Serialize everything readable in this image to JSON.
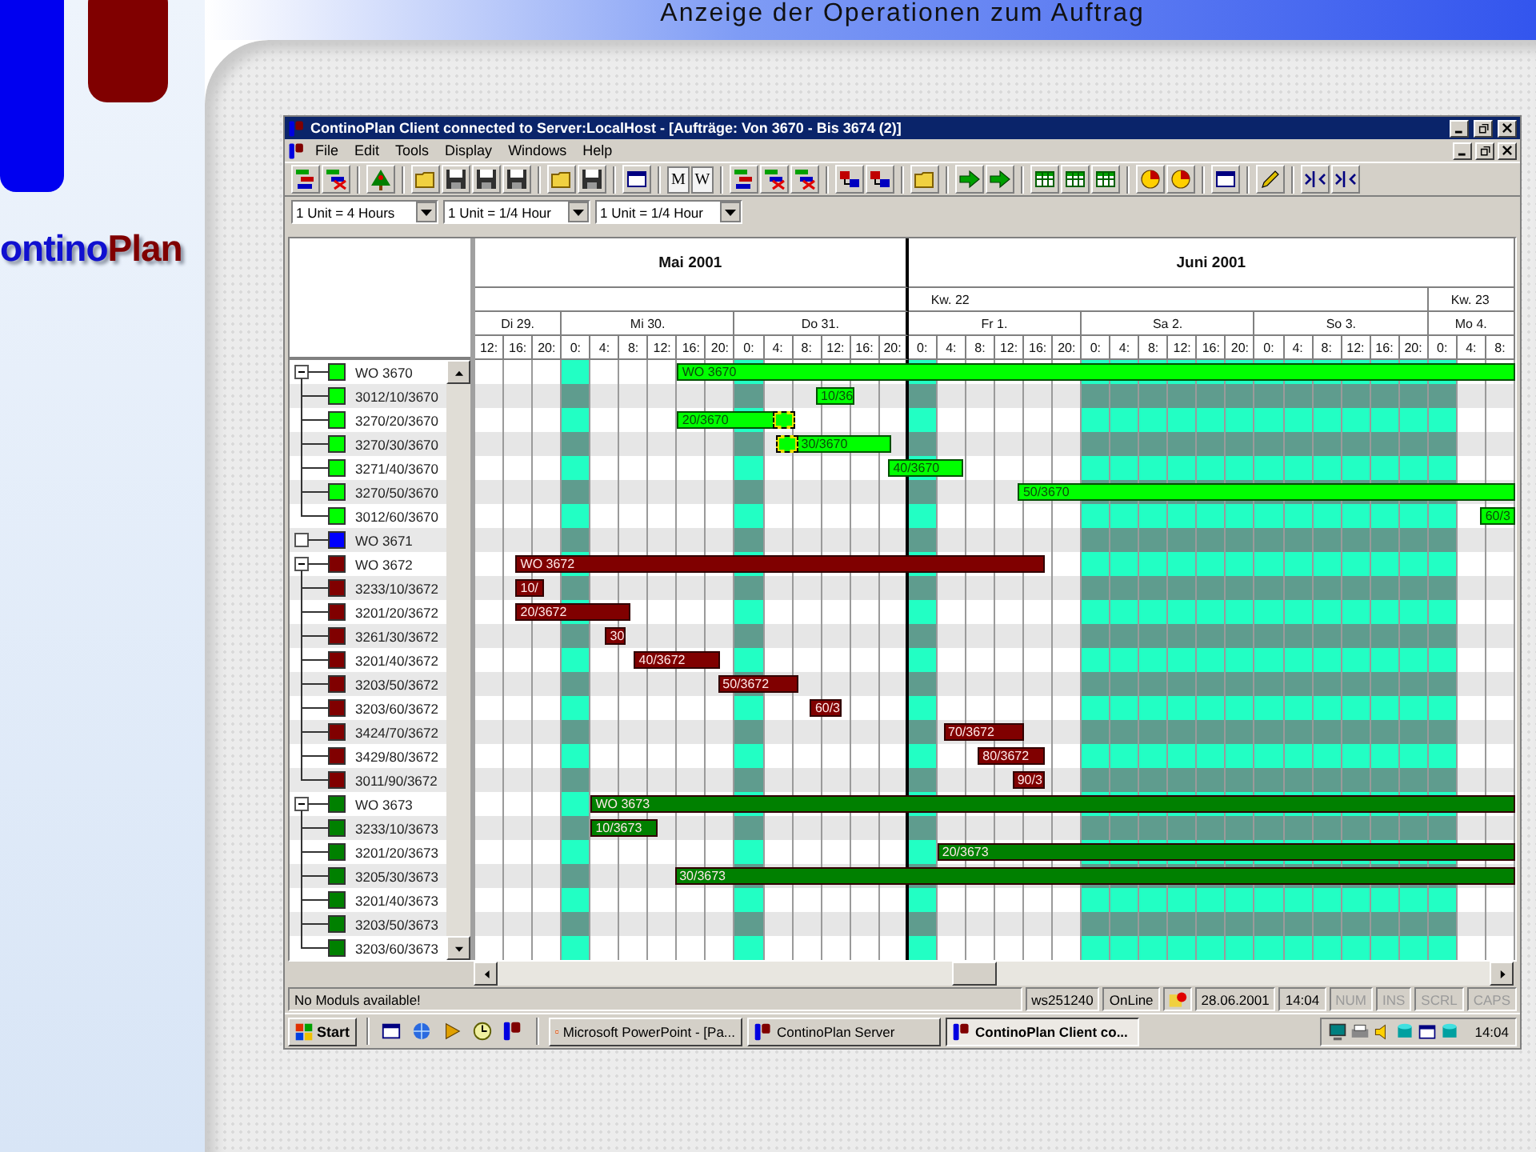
{
  "slide": {
    "title": "Anzeige der Operationen zum Auftrag",
    "logo": {
      "text": "ontino",
      "text_accent": "Plan"
    }
  },
  "window": {
    "title": "ContinoPlan Client connected to Server:LocalHost - [Aufträge: Von 3670 - Bis 3674 (2)]"
  },
  "menu": [
    "File",
    "Edit",
    "Tools",
    "Display",
    "Windows",
    "Help"
  ],
  "toolbar": {
    "view_buttons": [
      "M",
      "W"
    ]
  },
  "scale_selectors": [
    "1 Unit = 4 Hours",
    "1 Unit = 1/4 Hour",
    "1 Unit = 1/4 Hour"
  ],
  "timeline": {
    "months": [
      "Mai 2001",
      "Juni 2001"
    ],
    "weeks": [
      "Kw. 22",
      "Kw. 23"
    ],
    "days": [
      "Di 29.",
      "Mi 30.",
      "Do 31.",
      "Fr 1.",
      "Sa 2.",
      "So 3.",
      "Mo 4."
    ],
    "hours": [
      {
        "label": "12:",
        "off": false
      },
      {
        "label": "16:",
        "off": false
      },
      {
        "label": "20:",
        "off": false
      },
      {
        "label": "0:",
        "off": true
      },
      {
        "label": "4:",
        "off": false
      },
      {
        "label": "8:",
        "off": false
      },
      {
        "label": "12:",
        "off": false
      },
      {
        "label": "16:",
        "off": false
      },
      {
        "label": "20:",
        "off": false
      },
      {
        "label": "0:",
        "off": true
      },
      {
        "label": "4:",
        "off": false
      },
      {
        "label": "8:",
        "off": false
      },
      {
        "label": "12:",
        "off": false
      },
      {
        "label": "16:",
        "off": false
      },
      {
        "label": "20:",
        "off": false
      },
      {
        "label": "0:",
        "off": true
      },
      {
        "label": "4:",
        "off": false
      },
      {
        "label": "8:",
        "off": false
      },
      {
        "label": "12:",
        "off": false
      },
      {
        "label": "16:",
        "off": false
      },
      {
        "label": "20:",
        "off": false
      },
      {
        "label": "0:",
        "off": true
      },
      {
        "label": "4:",
        "off": true
      },
      {
        "label": "8:",
        "off": true
      },
      {
        "label": "12:",
        "off": true
      },
      {
        "label": "16:",
        "off": true
      },
      {
        "label": "20:",
        "off": true
      },
      {
        "label": "0:",
        "off": true
      },
      {
        "label": "4:",
        "off": true
      },
      {
        "label": "8:",
        "off": true
      },
      {
        "label": "12:",
        "off": true
      },
      {
        "label": "16:",
        "off": true
      },
      {
        "label": "20:",
        "off": true
      },
      {
        "label": "0:",
        "off": true
      },
      {
        "label": "4:",
        "off": false
      },
      {
        "label": "8:",
        "off": false
      }
    ]
  },
  "orders": [
    {
      "label": "WO 3670",
      "color": "#00ff00",
      "expanded": true,
      "bar": {
        "label": "WO 3670"
      },
      "children": [
        {
          "label": "3012/10/3670",
          "bar": {
            "label": "10/36"
          }
        },
        {
          "label": "3270/20/3670",
          "bar": {
            "label": "20/3670",
            "highlighted": true
          }
        },
        {
          "label": "3270/30/3670",
          "bar": {
            "label": "30/3670",
            "highlighted": true
          }
        },
        {
          "label": "3271/40/3670",
          "bar": {
            "label": "40/3670"
          }
        },
        {
          "label": "3270/50/3670",
          "bar": {
            "label": "50/3670"
          }
        },
        {
          "label": "3012/60/3670",
          "bar": {
            "label": "60/3"
          }
        }
      ]
    },
    {
      "label": "WO 3671",
      "color": "#0000ff",
      "expanded": false
    },
    {
      "label": "WO 3672",
      "color": "#800000",
      "expanded": true,
      "bar": {
        "label": "WO 3672"
      },
      "children": [
        {
          "label": "3233/10/3672",
          "bar": {
            "label": "10/"
          }
        },
        {
          "label": "3201/20/3672",
          "bar": {
            "label": "20/3672"
          }
        },
        {
          "label": "3261/30/3672",
          "bar": {
            "label": "30"
          }
        },
        {
          "label": "3201/40/3672",
          "bar": {
            "label": "40/3672"
          }
        },
        {
          "label": "3203/50/3672",
          "bar": {
            "label": "50/3672"
          }
        },
        {
          "label": "3203/60/3672",
          "bar": {
            "label": "60/3"
          }
        },
        {
          "label": "3424/70/3672",
          "bar": {
            "label": "70/3672"
          }
        },
        {
          "label": "3429/80/3672",
          "bar": {
            "label": "80/3672"
          }
        },
        {
          "label": "3011/90/3672",
          "bar": {
            "label": "90/3"
          }
        }
      ]
    },
    {
      "label": "WO 3673",
      "color": "#008000",
      "expanded": true,
      "bar": {
        "label": "WO 3673"
      },
      "children": [
        {
          "label": "3233/10/3673",
          "bar": {
            "label": "10/3673"
          }
        },
        {
          "label": "3201/20/3673",
          "bar": {
            "label": "20/3673"
          }
        },
        {
          "label": "3205/30/3673",
          "bar": {
            "label": "30/3673"
          }
        },
        {
          "label": "3201/40/3673"
        },
        {
          "label": "3203/50/3673"
        },
        {
          "label": "3203/60/3673"
        }
      ]
    }
  ],
  "status_bar": {
    "message": "No Moduls available!",
    "workstation": "ws251240",
    "connection": "OnLine",
    "date": "28.06.2001",
    "time": "14:04",
    "indicators": [
      {
        "label": "NUM",
        "active": false
      },
      {
        "label": "INS",
        "active": false
      },
      {
        "label": "SCRL",
        "active": false
      },
      {
        "label": "CAPS",
        "active": false
      }
    ]
  },
  "taskbar": {
    "start": "Start",
    "tasks": [
      {
        "label": "Microsoft PowerPoint - [Pa...",
        "selected": false
      },
      {
        "label": "ContinoPlan Server",
        "selected": false
      },
      {
        "label": "ContinoPlan Client co...",
        "selected": true
      }
    ],
    "clock": "14:04"
  }
}
